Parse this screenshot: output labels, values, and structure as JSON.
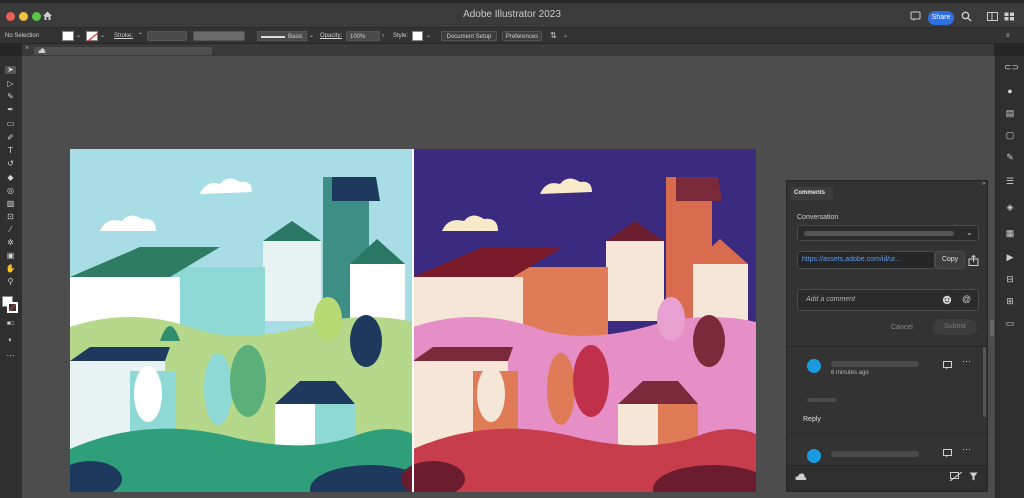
{
  "app": {
    "title": "Adobe Illustrator 2023",
    "share_label": "Share"
  },
  "control_bar": {
    "selection": "No Selection",
    "stroke_label": "Stroke:",
    "brush": "Basic",
    "opacity_label": "Opacity:",
    "opacity_value": "100%",
    "style_label": "Style:",
    "document_setup": "Document Setup",
    "preferences": "Preferences"
  },
  "comments_panel": {
    "tab": "Comments",
    "conversation_label": "Conversation",
    "link_url": "https://assets.adobe.com/id/ur...",
    "copy_label": "Copy",
    "add_comment_placeholder": "Add a comment",
    "cancel_label": "Cancel",
    "submit_label": "Submit",
    "comment_time": "6 minutes ago",
    "reply_label": "Reply"
  },
  "colors": {
    "accent": "#2f6fe0",
    "sky_left": "#a9dde6",
    "sky_right": "#3a2a80"
  }
}
